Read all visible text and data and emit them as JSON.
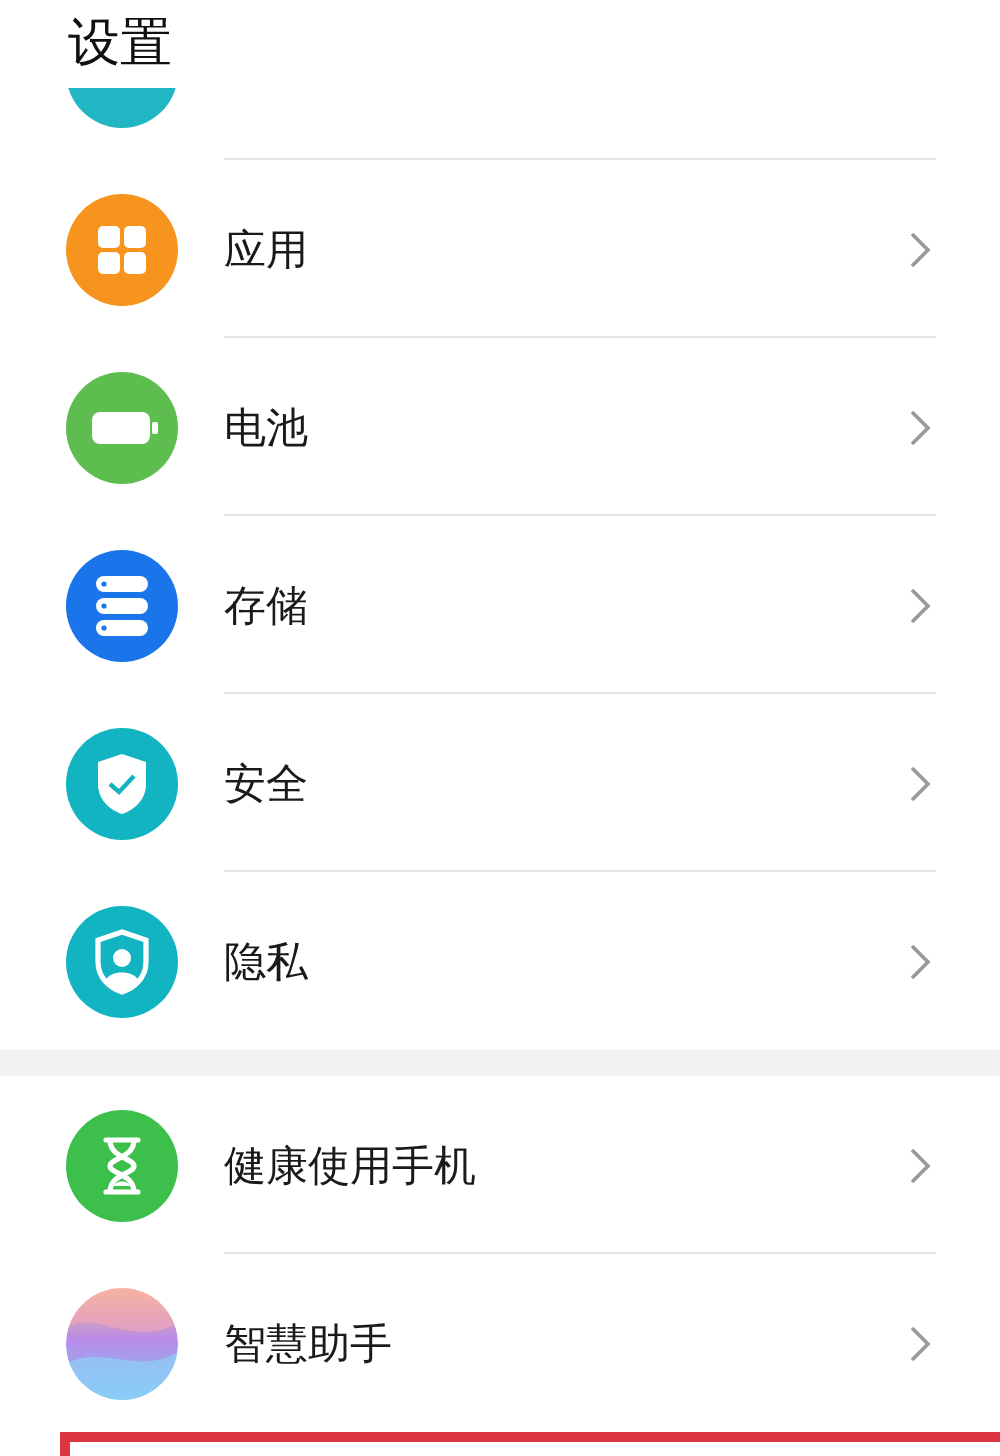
{
  "title": "设置",
  "groups": [
    {
      "items": [
        {
          "kind": "partial",
          "color": "#20b6c3"
        },
        {
          "kind": "apps",
          "label": "应用",
          "color": "#f7941d"
        },
        {
          "kind": "battery",
          "label": "电池",
          "color": "#5dbd4f"
        },
        {
          "kind": "storage",
          "label": "存储",
          "color": "#1a74ea"
        },
        {
          "kind": "security",
          "label": "安全",
          "color": "#13b4c1"
        },
        {
          "kind": "privacy",
          "label": "隐私",
          "color": "#13b4c1"
        }
      ]
    },
    {
      "items": [
        {
          "kind": "hourglass",
          "label": "健康使用手机",
          "color": "#3dbf4c"
        },
        {
          "kind": "assistant",
          "label": "智慧助手",
          "color": "#b98be8"
        }
      ]
    }
  ],
  "annotation": {
    "kind": "red-frame"
  }
}
